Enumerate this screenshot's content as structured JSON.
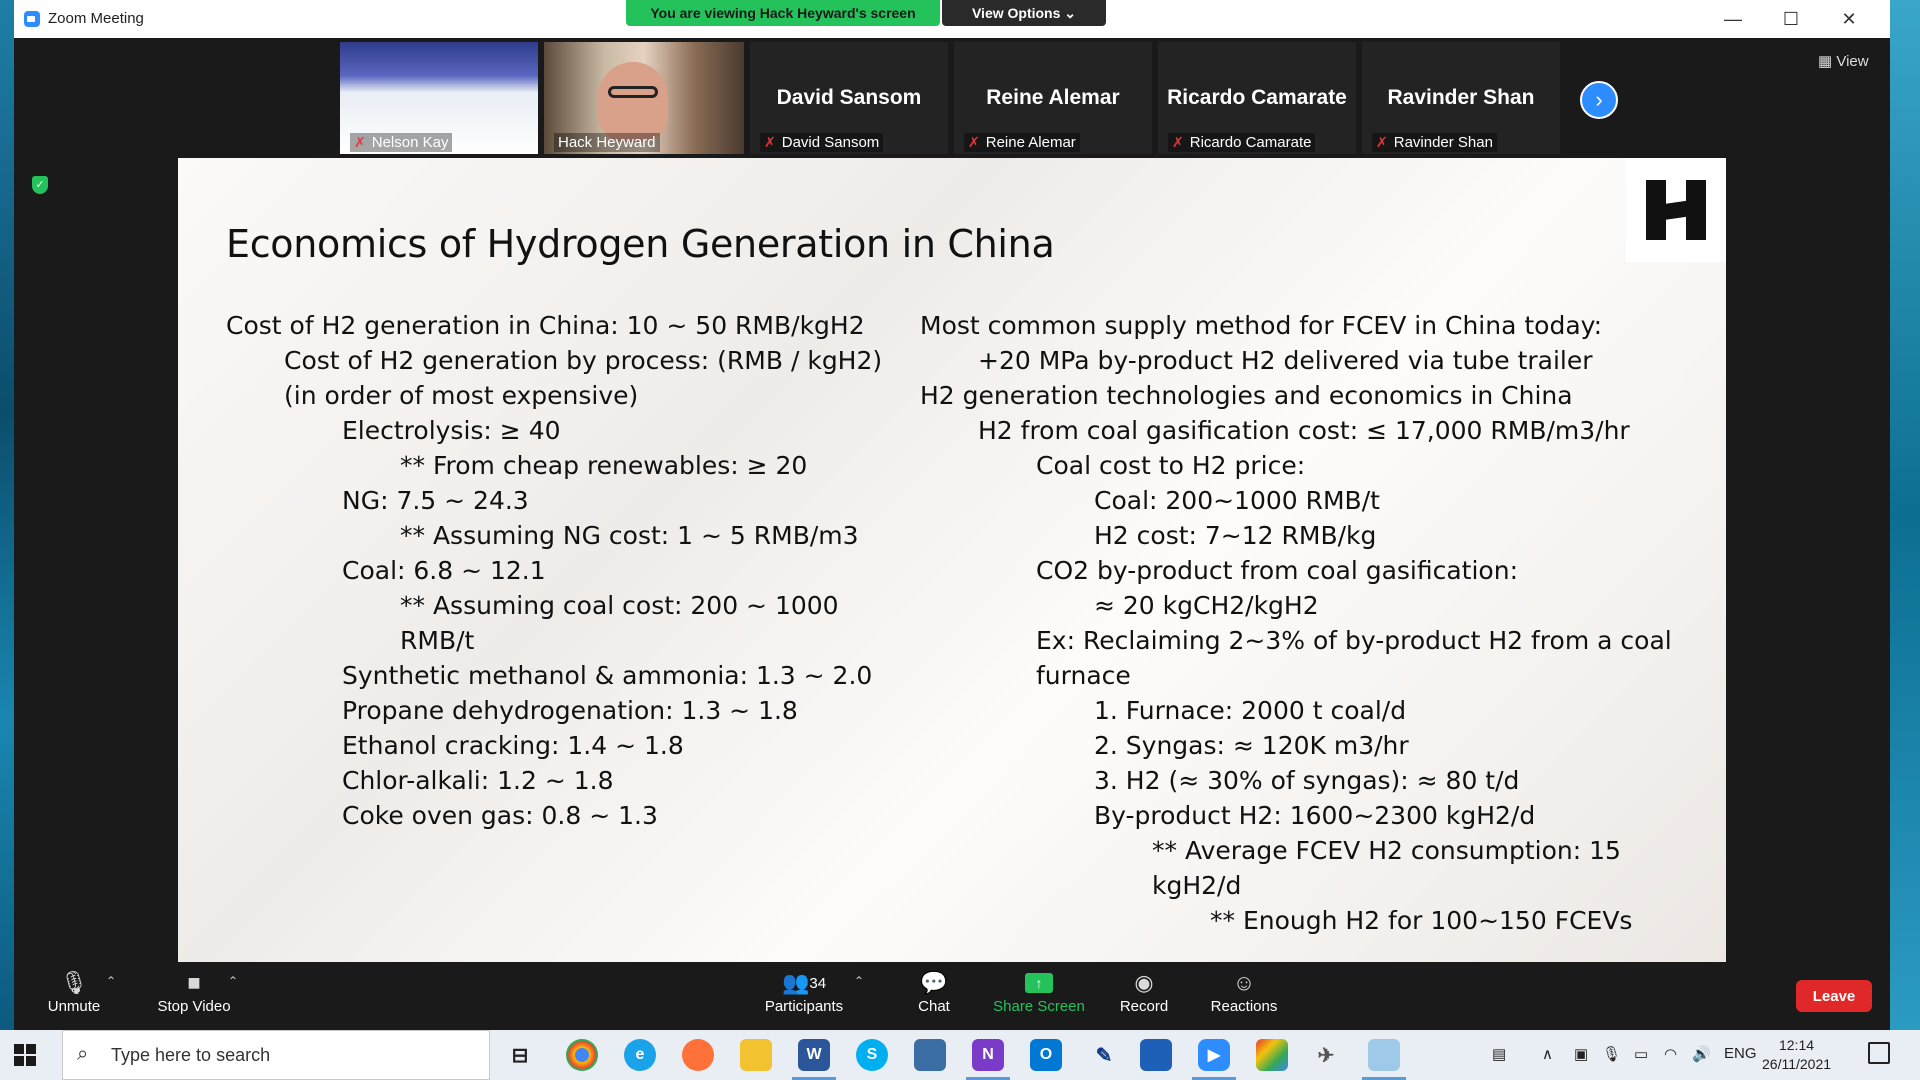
{
  "window": {
    "title": "Zoom Meeting"
  },
  "banner": {
    "viewing": "You are viewing Hack Heyward's screen",
    "view_options": "View Options ⌄"
  },
  "view_button": "▦ View",
  "participants_strip": [
    {
      "label": "Nelson Kay",
      "type": "video"
    },
    {
      "label": "Hack Heyward",
      "type": "video"
    },
    {
      "name": "David Sansom",
      "label": "David Sansom",
      "type": "name"
    },
    {
      "name": "Reine Alemar",
      "label": "Reine Alemar",
      "type": "name"
    },
    {
      "name": "Ricardo Camarate",
      "label": "Ricardo Camarate",
      "type": "name"
    },
    {
      "name": "Ravinder Shan",
      "label": "Ravinder Shan",
      "type": "name"
    }
  ],
  "slide": {
    "title": "Economics of Hydrogen Generation in China",
    "left": [
      {
        "level": 0,
        "text": "Cost of H2 generation in China: 10 ~ 50 RMB/kgH2"
      },
      {
        "level": 1,
        "text": "Cost of H2 generation by process: (RMB / kgH2)"
      },
      {
        "level": 1,
        "text": "(in order of most expensive)"
      },
      {
        "level": 2,
        "text": "Electrolysis: ≥ 40"
      },
      {
        "level": 3,
        "text": "** From cheap renewables: ≥ 20"
      },
      {
        "level": 2,
        "text": "NG: 7.5 ~ 24.3"
      },
      {
        "level": 3,
        "text": "** Assuming NG cost: 1 ~ 5 RMB/m3"
      },
      {
        "level": 2,
        "text": "Coal: 6.8 ~ 12.1"
      },
      {
        "level": 3,
        "text": "** Assuming coal cost: 200 ~ 1000"
      },
      {
        "level": 3,
        "text": "RMB/t"
      },
      {
        "level": 2,
        "text": "Synthetic methanol & ammonia: 1.3 ~ 2.0"
      },
      {
        "level": 2,
        "text": "Propane dehydrogenation: 1.3 ~ 1.8"
      },
      {
        "level": 2,
        "text": "Ethanol cracking: 1.4 ~ 1.8"
      },
      {
        "level": 2,
        "text": "Chlor-alkali: 1.2 ~ 1.8"
      },
      {
        "level": 2,
        "text": "Coke oven gas: 0.8 ~ 1.3"
      }
    ],
    "right": [
      {
        "level": 0,
        "text": "Most common supply method for FCEV in China today:"
      },
      {
        "level": 1,
        "text": "+20 MPa by-product H2 delivered via tube trailer"
      },
      {
        "level": 0,
        "text": "H2 generation technologies and economics in China"
      },
      {
        "level": 1,
        "text": "H2 from coal gasification cost: ≤ 17,000 RMB/m3/hr"
      },
      {
        "level": 2,
        "text": "Coal cost to H2 price:"
      },
      {
        "level": 3,
        "text": "Coal: 200~1000 RMB/t"
      },
      {
        "level": 3,
        "text": "H2 cost: 7~12 RMB/kg"
      },
      {
        "level": 2,
        "text": "CO2 by-product from coal gasification:"
      },
      {
        "level": 3,
        "text": "≈ 20 kgCH2/kgH2"
      },
      {
        "level": 2,
        "text": "Ex: Reclaiming 2~3% of by-product H2 from a coal"
      },
      {
        "level": 2,
        "text": "furnace"
      },
      {
        "level": 3,
        "text": "1. Furnace: 2000 t coal/d"
      },
      {
        "level": 3,
        "text": "2. Syngas: ≈ 120K m3/hr"
      },
      {
        "level": 3,
        "text": "3. H2 (≈ 30% of syngas): ≈ 80 t/d"
      },
      {
        "level": 3,
        "text": "By-product H2: 1600~2300 kgH2/d"
      },
      {
        "level": 4,
        "text": "** Average FCEV H2 consumption: 15"
      },
      {
        "level": 4,
        "text": "kgH2/d"
      },
      {
        "level": 5,
        "text": "** Enough H2 for 100~150 FCEVs"
      }
    ]
  },
  "toolbar": {
    "unmute": "Unmute",
    "stop_video": "Stop Video",
    "participants": "Participants",
    "participants_count": "34",
    "chat": "Chat",
    "share_screen": "Share Screen",
    "record": "Record",
    "reactions": "Reactions",
    "leave": "Leave"
  },
  "taskbar": {
    "search_placeholder": "Type here to search",
    "language": "ENG",
    "time": "12:14",
    "date": "26/11/2021"
  },
  "colors": {
    "zoom_blue": "#2d8cff",
    "banner_green": "#23c25a",
    "leave_red": "#e02828"
  }
}
